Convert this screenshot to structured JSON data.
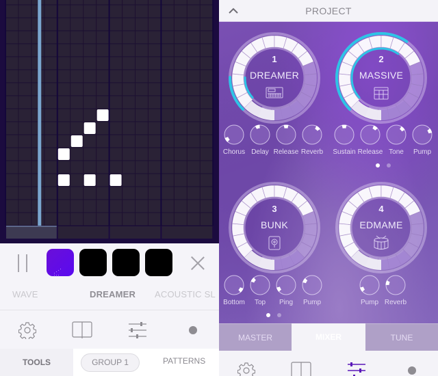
{
  "sequencer": {
    "columns": 16,
    "rows": 17,
    "playhead_column": 2.6,
    "notes": [
      {
        "col": 7,
        "row": 8
      },
      {
        "col": 6,
        "row": 9
      },
      {
        "col": 5,
        "row": 10
      },
      {
        "col": 4,
        "row": 11
      },
      {
        "col": 4,
        "row": 13
      },
      {
        "col": 6,
        "row": 13
      },
      {
        "col": 8,
        "row": 13
      }
    ],
    "bar_segments": 4,
    "active_segment": 0,
    "colors": {
      "background": "#1b0b3f",
      "cell": "#2a2236",
      "note": "#ffffff",
      "playhead": "#7aa6cf"
    }
  },
  "pattern_bar": {
    "pause_icon": "pause-icon",
    "patterns": [
      {
        "id": 1,
        "active": true,
        "color": "#6410e0"
      },
      {
        "id": 2,
        "active": false,
        "color": "#000000"
      },
      {
        "id": 3,
        "active": false,
        "color": "#000000"
      },
      {
        "id": 4,
        "active": false,
        "color": "#000000"
      }
    ],
    "close_icon": "close-icon"
  },
  "instrument_carousel": {
    "items": [
      {
        "label": "WAVE",
        "active": false
      },
      {
        "label": "DREAMER",
        "active": true
      },
      {
        "label": "ACOUSTIC SL",
        "active": false
      }
    ]
  },
  "left_toolbar": {
    "icons": [
      "gear-icon",
      "book-icon",
      "sliders-icon",
      "record-dot-icon"
    ]
  },
  "left_tabs": {
    "tools": "TOOLS",
    "group": "GROUP 1",
    "patterns": "PATTERNS"
  },
  "project": {
    "title": "PROJECT",
    "collapse_icon": "chevron-up-icon",
    "accent": "#2ec4e6",
    "pages": [
      {
        "active_dot": 0,
        "dot_count": 2,
        "dials": [
          {
            "number": "1",
            "name": "DREAMER",
            "icon": "keyboard-synth-icon",
            "level": 0.17,
            "knobs": [
              {
                "label": "Chorus",
                "value": 0.04
              },
              {
                "label": "Delay",
                "value": 0.44
              },
              {
                "label": "Release",
                "value": 0.5
              },
              {
                "label": "Reverb",
                "value": 0.65
              }
            ]
          },
          {
            "number": "2",
            "name": "MASSIVE",
            "icon": "drum-pad-icon",
            "level": 0.63,
            "knobs": [
              {
                "label": "Sustain",
                "value": 0.5
              },
              {
                "label": "Release",
                "value": 0.63
              },
              {
                "label": "Tone",
                "value": 0.67
              },
              {
                "label": "Pump",
                "value": 0.74
              }
            ]
          }
        ]
      },
      {
        "active_dot": 0,
        "dot_count": 2,
        "dials": [
          {
            "number": "3",
            "name": "BUNK",
            "icon": "speaker-icon",
            "level": 0,
            "knobs": [
              {
                "label": "Bottom",
                "value": 0.96
              },
              {
                "label": "Top",
                "value": 0.3
              },
              {
                "label": "Ping",
                "value": 0.06
              },
              {
                "label": "Pump",
                "value": 0.28
              }
            ]
          },
          {
            "number": "4",
            "name": "EDMAME",
            "icon": "drum-icon",
            "level": 0,
            "knobs": [
              {
                "label": "Pump",
                "value": 0.06
              },
              {
                "label": "Reverb",
                "value": 0.22
              }
            ]
          }
        ]
      }
    ],
    "tabs": [
      {
        "label": "MASTER",
        "active": false
      },
      {
        "label": "MIXER",
        "active": true
      },
      {
        "label": "TUNE",
        "active": false
      }
    ]
  },
  "right_toolbar": {
    "icons": [
      "gear-icon",
      "book-icon",
      "sliders-icon",
      "record-dot-icon"
    ],
    "active": "sliders-icon",
    "active_color": "#5a16b8"
  }
}
